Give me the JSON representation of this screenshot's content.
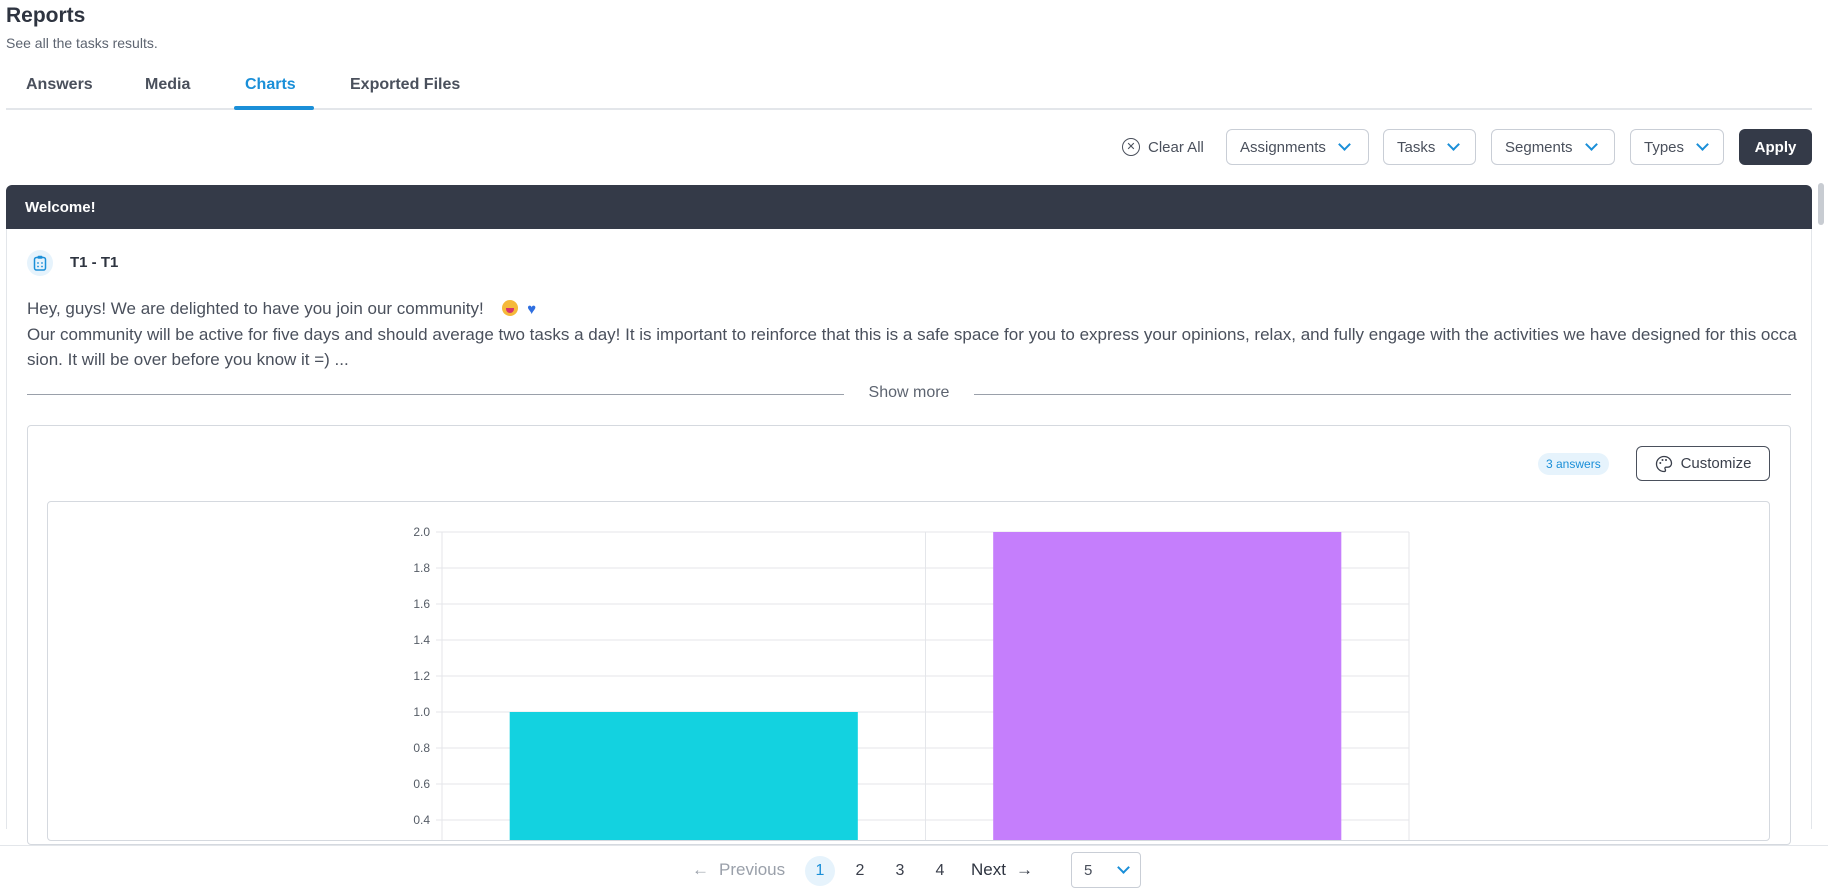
{
  "header": {
    "title": "Reports",
    "subtitle": "See all the tasks results."
  },
  "tabs": [
    {
      "label": "Answers",
      "active": false
    },
    {
      "label": "Media",
      "active": false
    },
    {
      "label": "Charts",
      "active": true
    },
    {
      "label": "Exported Files",
      "active": false
    }
  ],
  "filters": {
    "clear_all": "Clear All",
    "assignments": "Assignments",
    "tasks": "Tasks",
    "segments": "Segments",
    "types": "Types",
    "apply": "Apply"
  },
  "section": {
    "title": "Welcome!",
    "task_label": "T1 - T1",
    "message_line1": "Hey, guys! We are delighted to have you join our community!",
    "message_line2": "Our community will be active for five days and should average two tasks a day! It is important to reinforce that this is a safe space for you to express your opinions, relax, and fully engage with the activities we have designed for this occasion. It will be over before you know it =)  ...",
    "show_more": "Show more"
  },
  "chart_card": {
    "answers_badge": "3 answers",
    "customize": "Customize"
  },
  "chart_data": {
    "type": "bar",
    "categories": [
      "",
      ""
    ],
    "values": [
      1.0,
      2.0
    ],
    "colors": [
      "#13d2e0",
      "#c57efc"
    ],
    "ylim": [
      0.4,
      2.0
    ],
    "yticks": [
      "0.4",
      "0.6",
      "0.8",
      "1.0",
      "1.2",
      "1.4",
      "1.6",
      "1.8",
      "2.0"
    ],
    "grid": true
  },
  "pagination": {
    "previous": "Previous",
    "pages": [
      "1",
      "2",
      "3",
      "4"
    ],
    "current": "1",
    "next": "Next",
    "page_size": "5"
  }
}
